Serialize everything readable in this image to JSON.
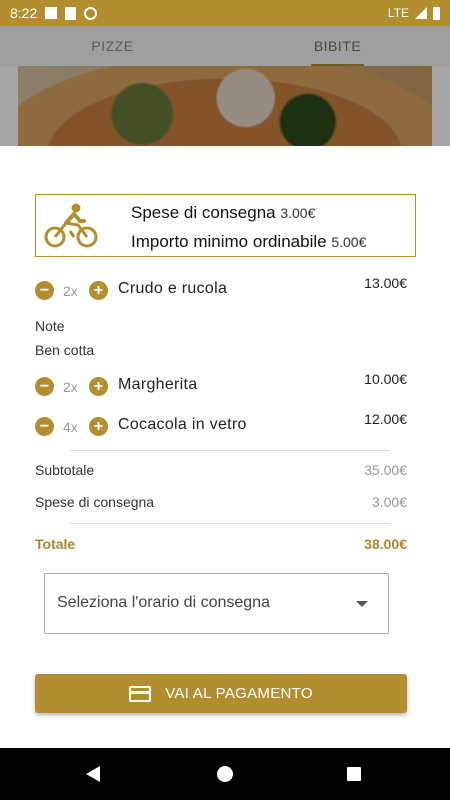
{
  "status_bar": {
    "time": "8:22",
    "network": "LTE"
  },
  "tabs": [
    {
      "label": "PIZZE"
    },
    {
      "label": "BIBITE"
    }
  ],
  "delivery_info": {
    "fee_label": "Spese di consegna",
    "fee_value": "3.00€",
    "min_order_label": "Importo minimo ordinabile",
    "min_order_value": "5.00€"
  },
  "items": [
    {
      "qty": "2x",
      "name": "Crudo e rucola",
      "price": "13.00€"
    },
    {
      "qty": "2x",
      "name": "Margherita",
      "price": "10.00€"
    },
    {
      "qty": "4x",
      "name": "Cocacola in vetro",
      "price": "12.00€"
    }
  ],
  "notes": {
    "label": "Note",
    "text": "Ben cotta"
  },
  "summary": {
    "subtotal_label": "Subtotale",
    "subtotal_value": "35.00€",
    "delivery_label": "Spese di consegna",
    "delivery_value": "3.00€",
    "total_label": "Totale",
    "total_value": "38.00€"
  },
  "delivery_time": {
    "placeholder": "Seleziona l'orario di consegna"
  },
  "pay_button": {
    "label": "VAI AL PAGAMENTO"
  },
  "colors": {
    "accent": "#b38e2e"
  },
  "icons": [
    "bicycle-icon",
    "credit-card-icon",
    "dropdown-arrow-icon",
    "minus-icon",
    "plus-icon"
  ]
}
